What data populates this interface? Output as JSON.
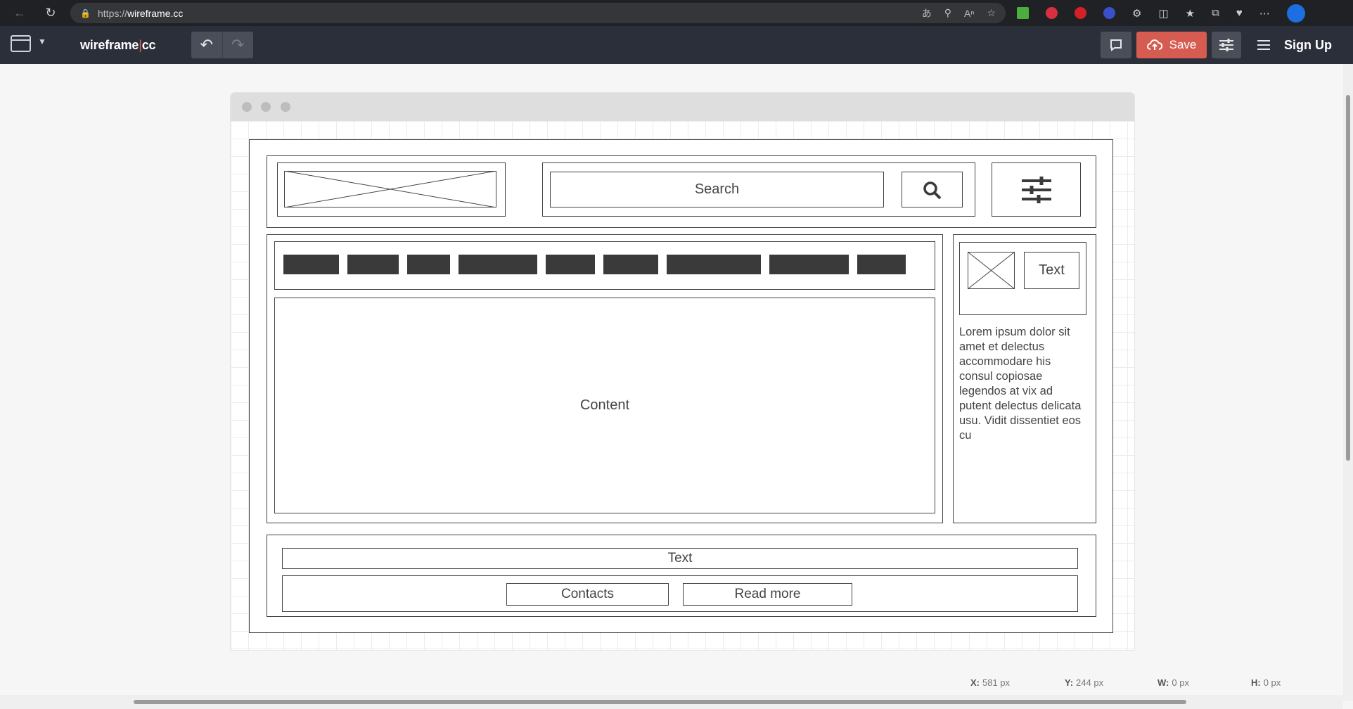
{
  "browser": {
    "url_scheme": "https://",
    "url_host": "wireframe.cc"
  },
  "toolbar": {
    "logo_main": "wireframe",
    "logo_sep": "|",
    "logo_suffix": "cc",
    "save_label": "Save",
    "signup_label": "Sign Up"
  },
  "wireframe": {
    "search_placeholder": "Search",
    "content_label": "Content",
    "sidebar_card_text": "Text",
    "sidebar_paragraph": "Lorem ipsum dolor sit amet et delectus accommodare his consul copiosae legendos at vix ad putent delectus delicata usu. Vidit dissentiet eos cu",
    "footer_text": "Text",
    "footer_contacts": "Contacts",
    "footer_read_more": "Read more",
    "nav_item_count": 9
  },
  "status": {
    "x_label": "X:",
    "x_value": "581 px",
    "y_label": "Y:",
    "y_value": "244 px",
    "w_label": "W:",
    "w_value": "0 px",
    "h_label": "H:",
    "h_value": "0 px"
  },
  "colors": {
    "save_accent": "#d65c52",
    "toolbar_bg": "#2b2f3a"
  }
}
